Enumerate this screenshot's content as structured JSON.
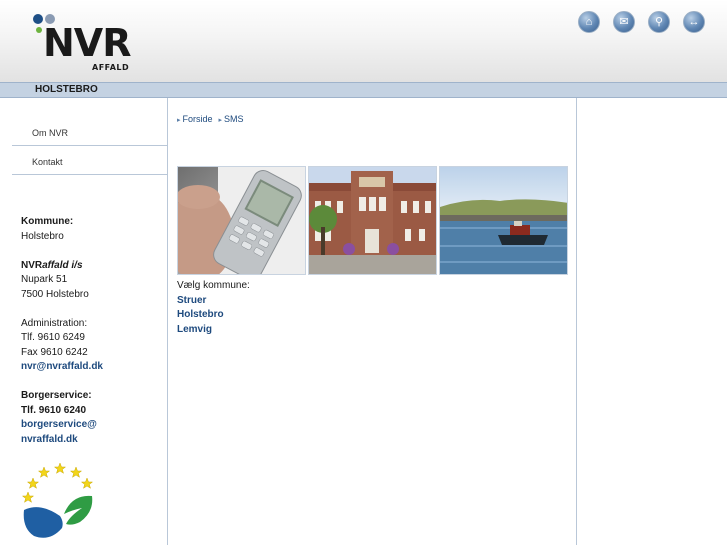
{
  "header": {
    "logo_text": "NVR",
    "logo_sub": "AFFALD",
    "icons": [
      "home-icon",
      "mail-icon",
      "search-icon",
      "sitemap-icon"
    ],
    "icon_glyphs": [
      "⌂",
      "✉",
      "⚲",
      "↔"
    ]
  },
  "location": "HOLSTEBRO",
  "sidebar": {
    "nav": [
      {
        "label": "Om NVR"
      },
      {
        "label": "Kontakt"
      }
    ]
  },
  "contact": {
    "kommune_label": "Kommune:",
    "kommune": "Holstebro",
    "company_nvr": "NVR",
    "company_rest": "affald i/s",
    "street": "Nupark 51",
    "city": "7500 Holstebro",
    "admin_label": "Administration:",
    "admin_phone": "Tlf. 9610 6249",
    "admin_fax": "Fax 9610 6242",
    "admin_email": "nvr@nvraffald.dk",
    "service_label": "Borgerservice:",
    "service_phone": "Tlf. 9610 6240",
    "service_email_1": "borgerservice@",
    "service_email_2": "nvraffald.dk"
  },
  "breadcrumb": [
    {
      "label": "Forside"
    },
    {
      "label": "SMS"
    }
  ],
  "photos": [
    "mobile-phone-photo",
    "town-hall-photo",
    "harbour-boat-photo"
  ],
  "choose": {
    "label": "Vælg kommune:",
    "options": [
      "Struer",
      "Holstebro",
      "Lemvig"
    ]
  },
  "colors": {
    "link": "#1e4a7e",
    "location_bar": "#c4d2e2",
    "logo_green": "#6db33f",
    "logo_blue": "#1e4f86"
  }
}
